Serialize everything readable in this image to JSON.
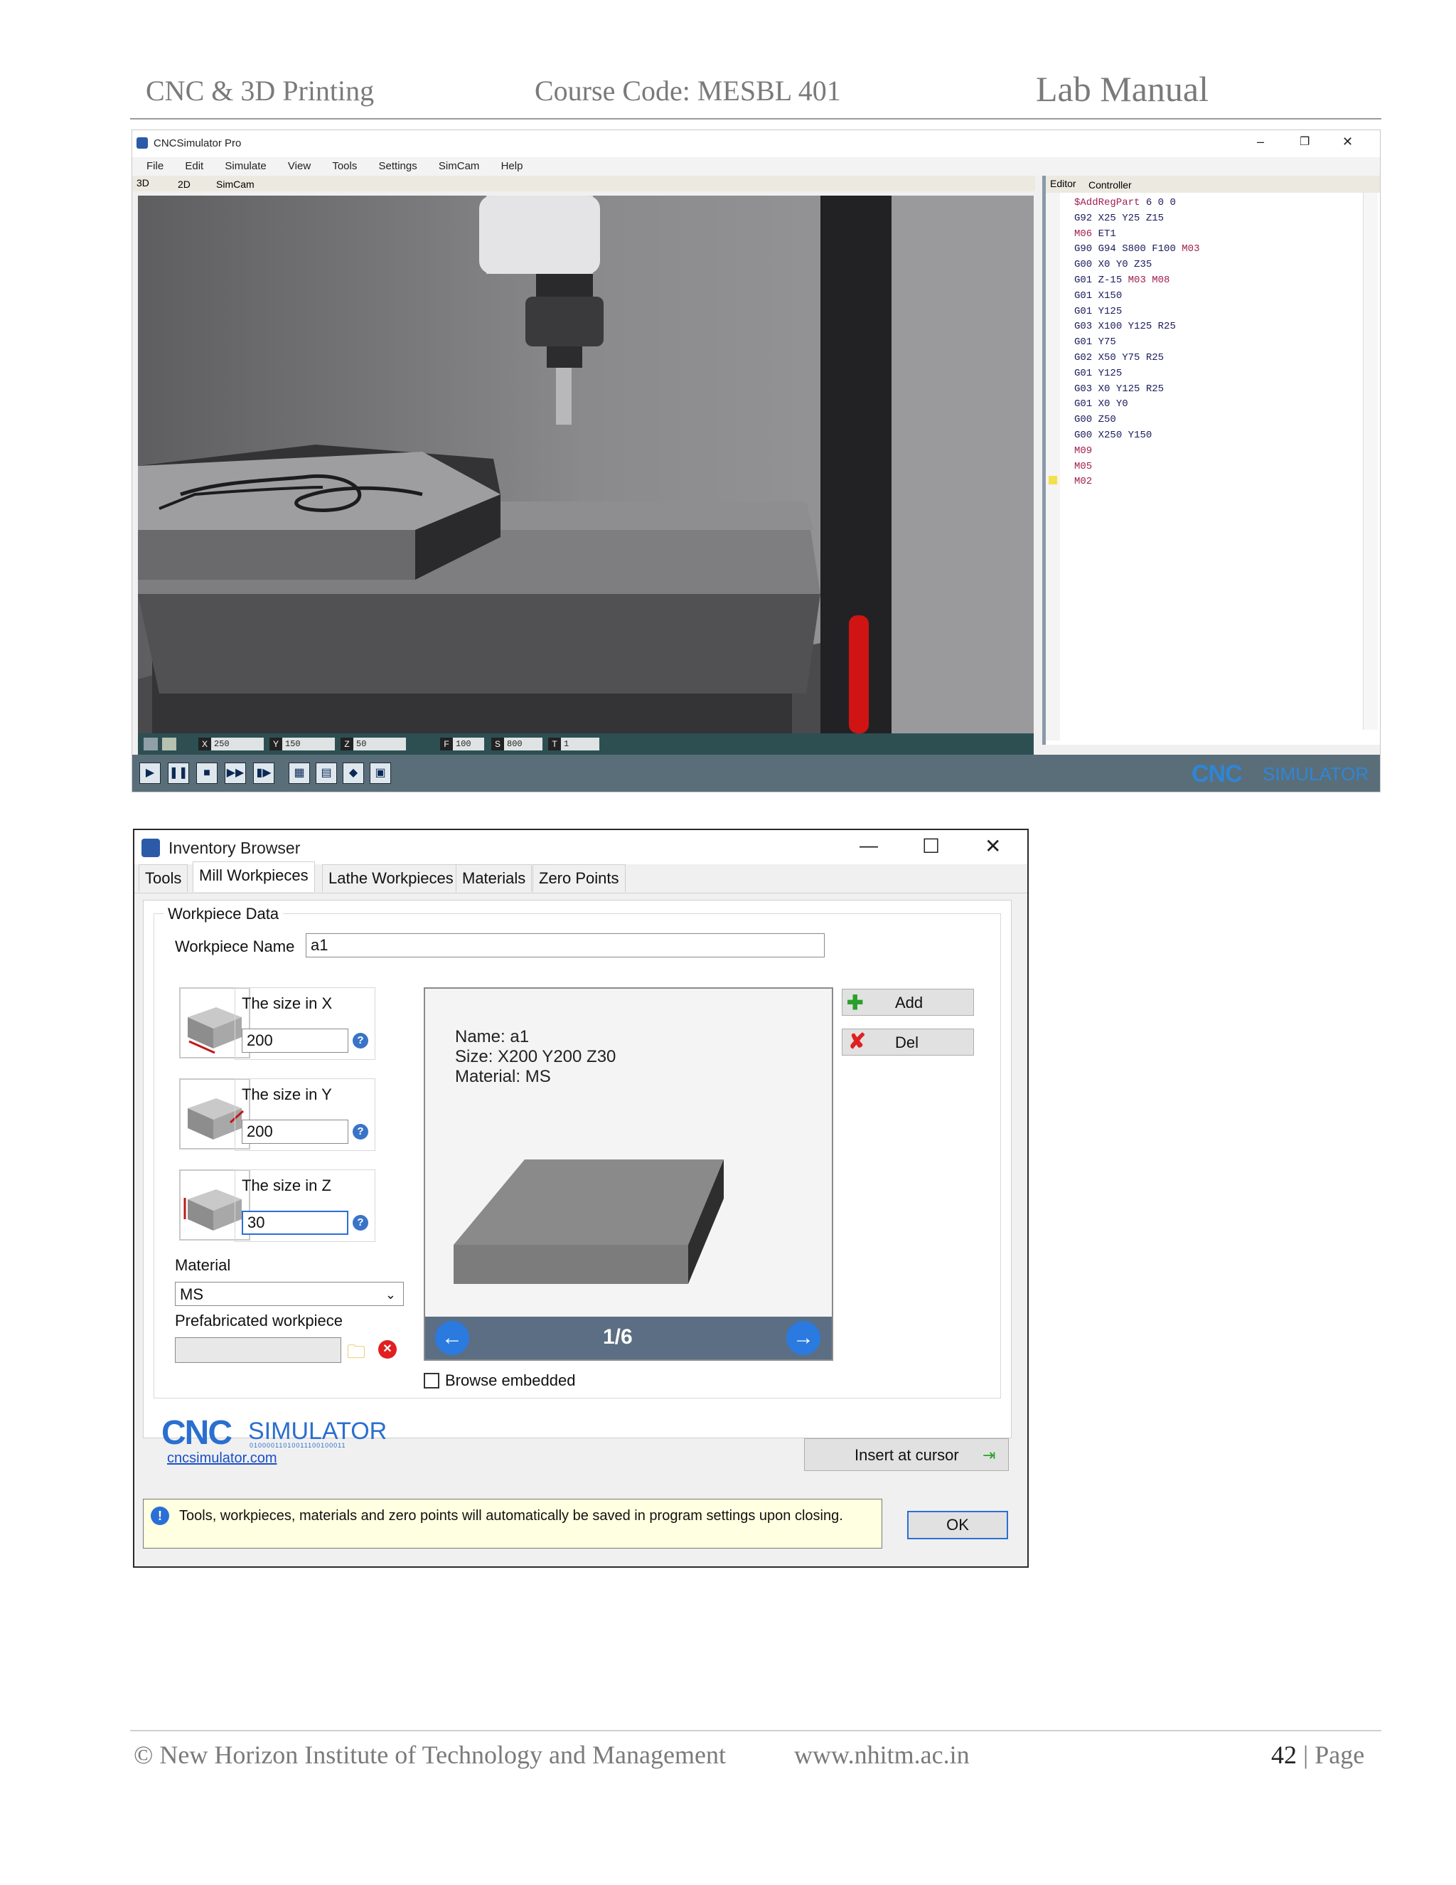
{
  "header": {
    "left": "CNC & 3D Printing",
    "center": "Course Code: MESBL 401",
    "right": "Lab Manual"
  },
  "cncsim": {
    "title": "CNCSimulator Pro",
    "window_controls": [
      "–",
      "❐",
      "✕"
    ],
    "menu": [
      "File",
      "Edit",
      "Simulate",
      "View",
      "Tools",
      "Settings",
      "SimCam",
      "Help"
    ],
    "view_tabs": [
      "3D",
      "2D",
      "SimCam"
    ],
    "editor_tabs": [
      "Editor",
      "Controller"
    ],
    "code_lines": [
      "$AddRegPart 6 0 0",
      "G92 X25 Y25 Z15",
      "M06 ET1",
      "G90 G94 S800 F100 M03",
      "G00 X0 Y0 Z35",
      "G01 Z-15 M03 M08",
      "G01 X150",
      "G01 Y125",
      "G03 X100 Y125 R25",
      "G01 Y75",
      "G02 X50 Y75 R25",
      "G01 Y125",
      "G03 X0 Y125 R25",
      "G01 X0 Y0",
      "G00 Z50",
      "G00 X250 Y150",
      "M09",
      "M05",
      "M02"
    ],
    "readouts": {
      "x_label": "X",
      "x": "250",
      "y_label": "Y",
      "y": "150",
      "z_label": "Z",
      "z": "50",
      "f_label": "F",
      "f": "100",
      "s_label": "S",
      "s": "800",
      "t_label": "T",
      "t": "1"
    },
    "logo": {
      "cnc": "CNC",
      "sim": "SIMULATOR"
    }
  },
  "inventory": {
    "title": "Inventory Browser",
    "window_controls": [
      "—",
      "☐",
      "✕"
    ],
    "tabs": [
      "Tools",
      "Mill Workpieces",
      "Lathe Workpieces",
      "Materials",
      "Zero Points"
    ],
    "group_label": "Workpiece Data",
    "name_label": "Workpiece Name",
    "name_value": "a1",
    "size_x_label": "The size in X",
    "size_x": "200",
    "size_y_label": "The size in Y",
    "size_y": "200",
    "size_z_label": "The size in Z",
    "size_z": "30",
    "material_label": "Material",
    "material_value": "MS",
    "prefab_label": "Prefabricated workpiece",
    "preview_name": "Name: a1",
    "preview_size": "Size: X200 Y200 Z30",
    "preview_material": "Material: MS",
    "preview_page": "1/6",
    "add_label": "Add",
    "del_label": "Del",
    "browse_embedded": "Browse embedded",
    "logo_cnc": "CNC",
    "logo_sim": "SIMULATOR",
    "logo_bits": "01000011010011100100011",
    "logo_url": "cncsimulator.com",
    "insert_label": "Insert at cursor",
    "info_text": "Tools, workpieces, materials and zero points will automatically be saved in program settings upon closing.",
    "ok_label": "OK"
  },
  "footer": {
    "left": "© New Horizon Institute of Technology and Management",
    "center": "www.nhitm.ac.in",
    "page_number": "42",
    "page_sep": " | ",
    "page_word": "Page"
  }
}
